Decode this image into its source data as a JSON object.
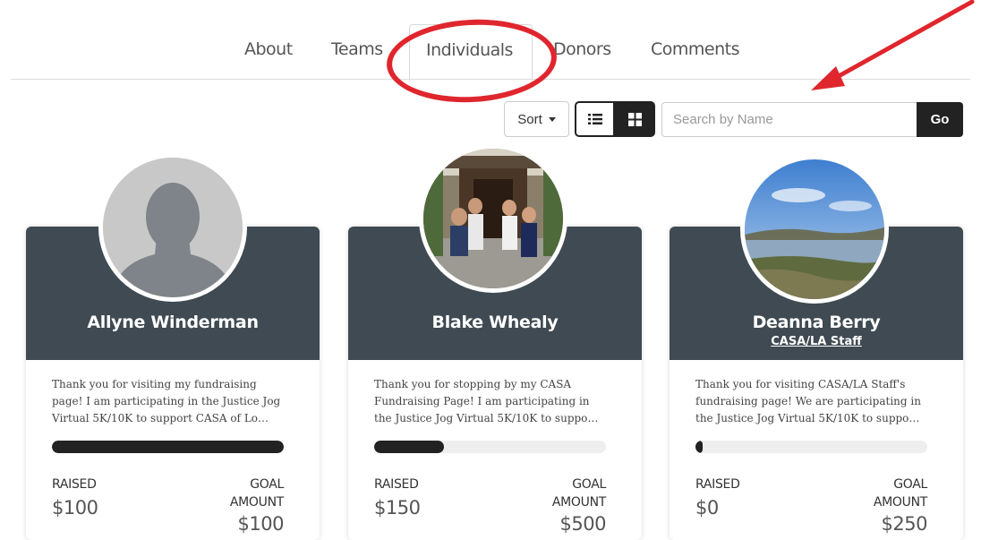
{
  "tabs": {
    "about": "About",
    "teams": "Teams",
    "individuals": "Individuals",
    "donors": "Donors",
    "comments": "Comments"
  },
  "toolbar": {
    "sort_label": "Sort",
    "search_placeholder": "Search by Name",
    "go_label": "Go"
  },
  "colors": {
    "card_header": "#3f4a52",
    "annotation_red": "#e0262d",
    "progress_fill": "#222222"
  },
  "cards": [
    {
      "name": "Allyne Winderman",
      "team": "",
      "desc_lines": [
        "Thank you for visiting my fundraising",
        "page! I am participating in the Justice Jog",
        "Virtual 5K/10K to support CASA of Lo…"
      ],
      "progress": 1.0,
      "raised_label": "RAISED",
      "raised": "$100",
      "goal_label_1": "GOAL",
      "goal_label_2": "AMOUNT",
      "goal": "$100",
      "avatar": "silhouette-placeholder"
    },
    {
      "name": "Blake Whealy",
      "team": "",
      "desc_lines": [
        "Thank you for stopping by my CASA",
        "Fundraising Page! I am participating in",
        "the Justice Jog Virtual 5K/10K to suppo…"
      ],
      "progress": 0.3,
      "raised_label": "RAISED",
      "raised": "$150",
      "goal_label_1": "GOAL",
      "goal_label_2": "AMOUNT",
      "goal": "$500",
      "avatar": "group-photo"
    },
    {
      "name": "Deanna Berry",
      "team": "CASA/LA Staff",
      "desc_lines": [
        "Thank you for visiting CASA/LA Staff's",
        "fundraising page! We are participating in",
        "the Justice Jog Virtual 5K/10K to suppo…"
      ],
      "progress": 0.03,
      "raised_label": "RAISED",
      "raised": "$0",
      "goal_label_1": "GOAL",
      "goal_label_2": "AMOUNT",
      "goal": "$250",
      "avatar": "lake-landscape-photo"
    }
  ]
}
